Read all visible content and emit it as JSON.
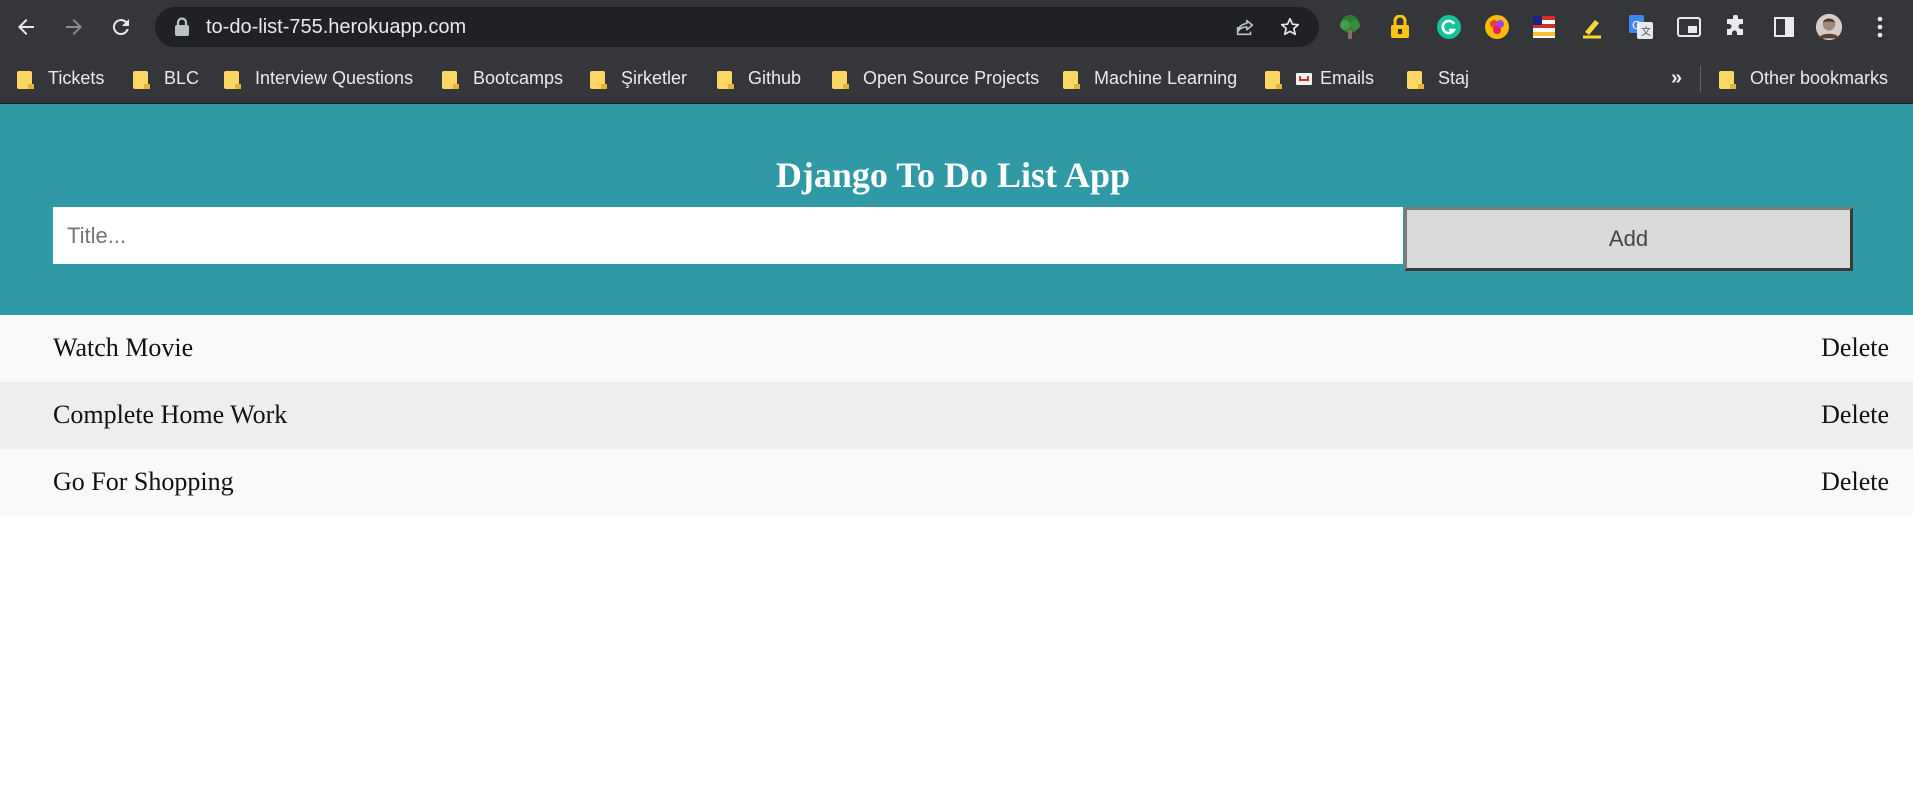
{
  "browser": {
    "url": "to-do-list-755.herokuapp.com",
    "bookmarks": [
      {
        "label": "Tickets"
      },
      {
        "label": "BLC"
      },
      {
        "label": "Interview Questions"
      },
      {
        "label": "Bootcamps"
      },
      {
        "label": "Şirketler"
      },
      {
        "label": "Github"
      },
      {
        "label": "Open Source Projects"
      },
      {
        "label": "Machine Learning"
      },
      {
        "label": "Emails"
      },
      {
        "label": "Staj"
      }
    ],
    "overflow_label": "»",
    "other_bookmarks": "Other bookmarks",
    "extensions": [
      "tree-extension-icon",
      "password-manager-icon",
      "grammarly-icon",
      "color-picker-icon",
      "flag-icon",
      "highlighter-icon",
      "google-translate-icon",
      "picture-in-picture-icon",
      "puzzle-extensions-icon",
      "side-panel-icon",
      "profile-avatar",
      "kebab-menu-icon"
    ]
  },
  "app": {
    "title": "Django To Do List App",
    "input_placeholder": "Title...",
    "add_label": "Add",
    "todos": [
      {
        "title": "Watch Movie",
        "delete_label": "Delete"
      },
      {
        "title": "Complete Home Work",
        "delete_label": "Delete"
      },
      {
        "title": "Go For Shopping",
        "delete_label": "Delete"
      }
    ]
  },
  "colors": {
    "header_bg": "#3099a6",
    "chrome_bg": "#35363a",
    "row_light": "#f9f9f9",
    "row_dark": "#eeeeee"
  }
}
